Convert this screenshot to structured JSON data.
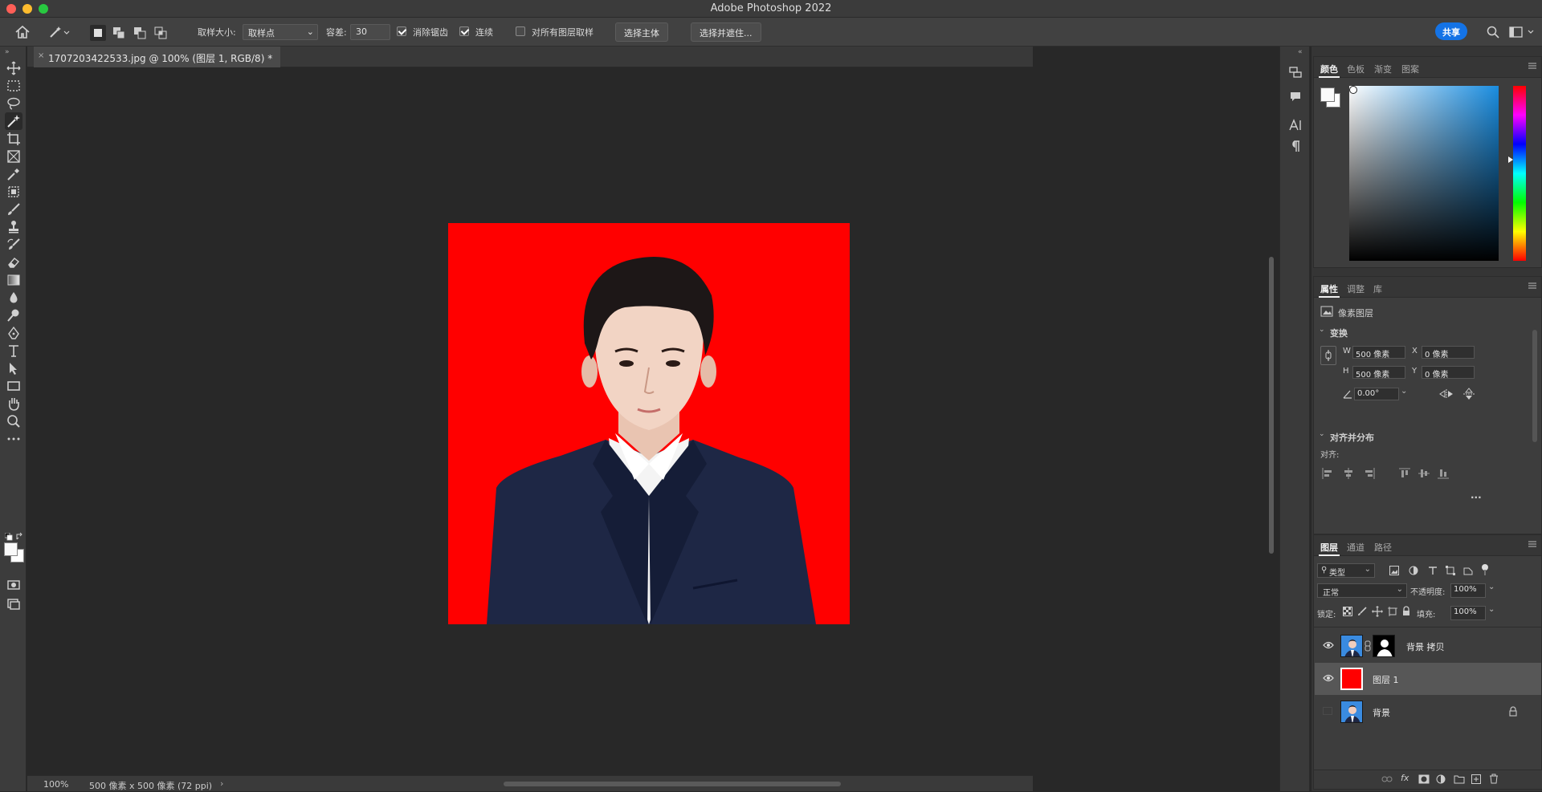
{
  "window": {
    "title": "Adobe Photoshop 2022"
  },
  "options_bar": {
    "sample_size_label": "取样大小:",
    "sample_size_value": "取样点",
    "tolerance_label": "容差:",
    "tolerance_value": "30",
    "antialias_label": "消除锯齿",
    "antialias_checked": true,
    "contiguous_label": "连续",
    "contiguous_checked": true,
    "sample_all_label": "对所有图层取样",
    "sample_all_checked": false,
    "select_subject_label": "选择主体",
    "select_mask_label": "选择并遮住...",
    "share_label": "共享"
  },
  "document": {
    "tab_title": "1707203422533.jpg @ 100% (图层 1, RGB/8) *",
    "background_color": "#ff0000"
  },
  "status_bar": {
    "zoom": "100%",
    "info": "500 像素 x 500 像素 (72 ppi)"
  },
  "color_panel": {
    "tabs": [
      "颜色",
      "色板",
      "渐变",
      "图案"
    ],
    "active_tab": "颜色"
  },
  "properties_panel": {
    "tabs": [
      "属性",
      "调整",
      "库"
    ],
    "layer_type": "像素图层",
    "transform_title": "变换",
    "w_label": "W",
    "w_value": "500 像素",
    "h_label": "H",
    "h_value": "500 像素",
    "x_label": "X",
    "x_value": "0 像素",
    "y_label": "Y",
    "y_value": "0 像素",
    "angle_value": "0.00°",
    "align_title": "对齐并分布",
    "align_label": "对齐:",
    "more_label": "···"
  },
  "layers_panel": {
    "tabs": [
      "图层",
      "通道",
      "路径"
    ],
    "filter_label": "类型",
    "blend_mode": "正常",
    "opacity_label": "不透明度:",
    "opacity_value": "100%",
    "lock_label": "锁定:",
    "fill_label": "填充:",
    "fill_value": "100%",
    "layers": [
      {
        "name": "背景 拷贝",
        "visible": true,
        "selected": false
      },
      {
        "name": "图层 1",
        "visible": true,
        "selected": true
      },
      {
        "name": "背景",
        "visible": false,
        "selected": false
      }
    ]
  },
  "colors": {
    "accent": "#1473e6",
    "red_layer": "#ff0000"
  }
}
